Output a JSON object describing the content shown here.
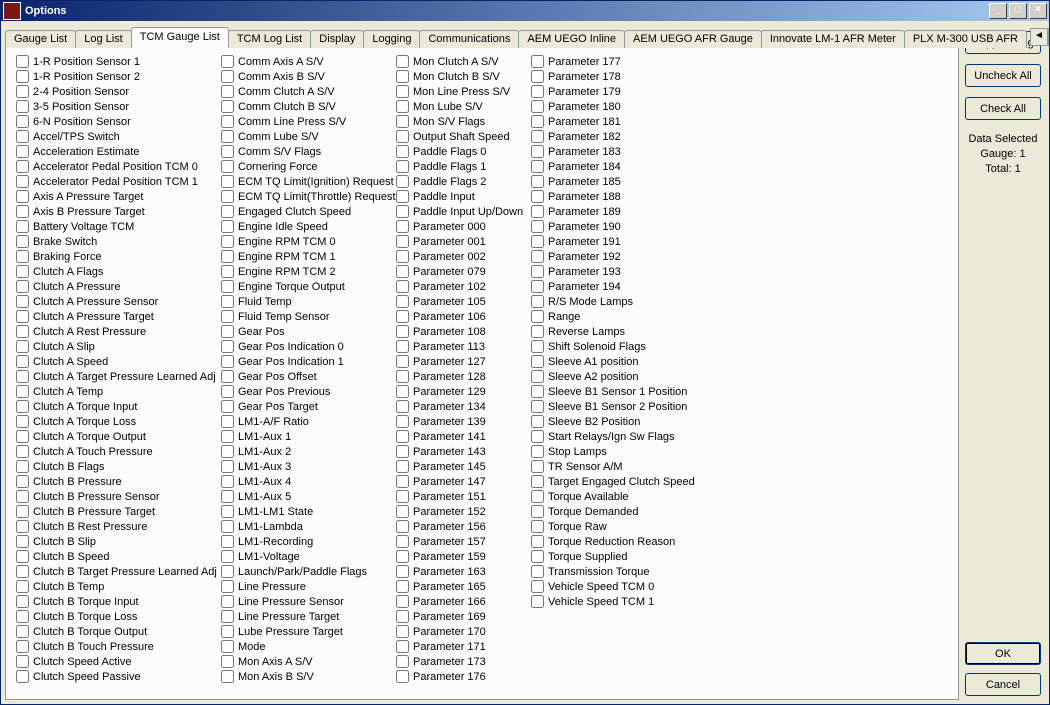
{
  "window": {
    "title": "Options"
  },
  "titlebar_buttons": {
    "min": "_",
    "max": "□",
    "close": "×"
  },
  "tabs": {
    "items": [
      {
        "label": "Gauge List"
      },
      {
        "label": "Log List"
      },
      {
        "label": "TCM Gauge List"
      },
      {
        "label": "TCM Log List"
      },
      {
        "label": "Display"
      },
      {
        "label": "Logging"
      },
      {
        "label": "Communications"
      },
      {
        "label": "AEM UEGO Inline"
      },
      {
        "label": "AEM UEGO AFR Gauge"
      },
      {
        "label": "Innovate LM-1 AFR Meter"
      },
      {
        "label": "PLX M-300 USB AFR"
      }
    ],
    "active_index": 2,
    "scroll_left": "◄",
    "scroll_right": "►"
  },
  "columns": [
    [
      "1-R Position Sensor 1",
      "1-R Position Sensor 2",
      "2-4 Position Sensor",
      "3-5 Position Sensor",
      "6-N Position Sensor",
      "Accel/TPS Switch",
      "Acceleration Estimate",
      "Accelerator Pedal Position TCM 0",
      "Accelerator Pedal Position TCM 1",
      "Axis A Pressure Target",
      "Axis B Pressure Target",
      "Battery Voltage TCM",
      "Brake Switch",
      "Braking Force",
      "Clutch A Flags",
      "Clutch A Pressure",
      "Clutch A Pressure Sensor",
      "Clutch A Pressure Target",
      "Clutch A Rest Pressure",
      "Clutch A Slip",
      "Clutch A Speed",
      "Clutch A Target Pressure Learned Adj",
      "Clutch A Temp",
      "Clutch A Torque Input",
      "Clutch A Torque Loss",
      "Clutch A Torque Output",
      "Clutch A Touch Pressure",
      "Clutch B Flags",
      "Clutch B Pressure",
      "Clutch B Pressure Sensor",
      "Clutch B Pressure Target",
      "Clutch B Rest Pressure",
      "Clutch B Slip",
      "Clutch B Speed",
      "Clutch B Target Pressure Learned Adj",
      "Clutch B Temp",
      "Clutch B Torque Input",
      "Clutch B Torque Loss",
      "Clutch B Torque Output",
      "Clutch B Touch Pressure",
      "Clutch Speed Active",
      "Clutch Speed Passive"
    ],
    [
      "Comm Axis A S/V",
      "Comm Axis B S/V",
      "Comm Clutch A S/V",
      "Comm Clutch B S/V",
      "Comm Line Press S/V",
      "Comm Lube S/V",
      "Comm S/V Flags",
      "Cornering Force",
      "ECM TQ Limit(Ignition) Request",
      "ECM TQ Limit(Throttle) Request",
      "Engaged Clutch Speed",
      "Engine Idle Speed",
      "Engine RPM TCM 0",
      "Engine RPM TCM 1",
      "Engine RPM TCM 2",
      "Engine Torque Output",
      "Fluid Temp",
      "Fluid Temp Sensor",
      "Gear Pos",
      "Gear Pos Indication 0",
      "Gear Pos Indication 1",
      "Gear Pos Offset",
      "Gear Pos Previous",
      "Gear Pos Target",
      "LM1-A/F Ratio",
      "LM1-Aux 1",
      "LM1-Aux 2",
      "LM1-Aux 3",
      "LM1-Aux 4",
      "LM1-Aux 5",
      "LM1-LM1 State",
      "LM1-Lambda",
      "LM1-Recording",
      "LM1-Voltage",
      "Launch/Park/Paddle Flags",
      "Line Pressure",
      "Line Pressure Sensor",
      "Line Pressure Target",
      "Lube Pressure Target",
      "Mode",
      "Mon Axis A S/V",
      "Mon Axis B S/V"
    ],
    [
      "Mon Clutch A S/V",
      "Mon Clutch B S/V",
      "Mon Line Press S/V",
      "Mon Lube S/V",
      "Mon S/V Flags",
      "Output Shaft Speed",
      "Paddle Flags 0",
      "Paddle Flags 1",
      "Paddle Flags 2",
      "Paddle Input",
      "Paddle Input Up/Down",
      "Parameter 000",
      "Parameter 001",
      "Parameter 002",
      "Parameter 079",
      "Parameter 102",
      "Parameter 105",
      "Parameter 106",
      "Parameter 108",
      "Parameter 113",
      "Parameter 127",
      "Parameter 128",
      "Parameter 129",
      "Parameter 134",
      "Parameter 139",
      "Parameter 141",
      "Parameter 143",
      "Parameter 145",
      "Parameter 147",
      "Parameter 151",
      "Parameter 152",
      "Parameter 156",
      "Parameter 157",
      "Parameter 159",
      "Parameter 163",
      "Parameter 165",
      "Parameter 166",
      "Parameter 169",
      "Parameter 170",
      "Parameter 171",
      "Parameter 173",
      "Parameter 176"
    ],
    [
      "Parameter 177",
      "Parameter 178",
      "Parameter 179",
      "Parameter 180",
      "Parameter 181",
      "Parameter 182",
      "Parameter 183",
      "Parameter 184",
      "Parameter 185",
      "Parameter 188",
      "Parameter 189",
      "Parameter 190",
      "Parameter 191",
      "Parameter 192",
      "Parameter 193",
      "Parameter 194",
      "R/S Mode Lamps",
      "Range",
      "Reverse Lamps",
      "Shift Solenoid Flags",
      "Sleeve A1 position",
      "Sleeve A2 position",
      "Sleeve B1 Sensor 1 Position",
      "Sleeve B1 Sensor 2 Position",
      "Sleeve B2 Position",
      "Start Relays/Ign Sw Flags",
      "Stop Lamps",
      "TR Sensor A/M",
      "Target Engaged Clutch Speed",
      "Torque Available",
      "Torque Demanded",
      "Torque Raw",
      "Torque Reduction Reason",
      "Torque Supplied",
      "Transmission Torque",
      "Vehicle Speed TCM 0",
      "Vehicle Speed TCM 1"
    ]
  ],
  "sidebar": {
    "copy": "Copy To Log",
    "uncheck": "Uncheck All",
    "check": "Check All",
    "info_line1": "Data Selected",
    "info_line2": "Gauge: 1",
    "info_line3": "Total: 1",
    "ok": "OK",
    "cancel": "Cancel"
  }
}
